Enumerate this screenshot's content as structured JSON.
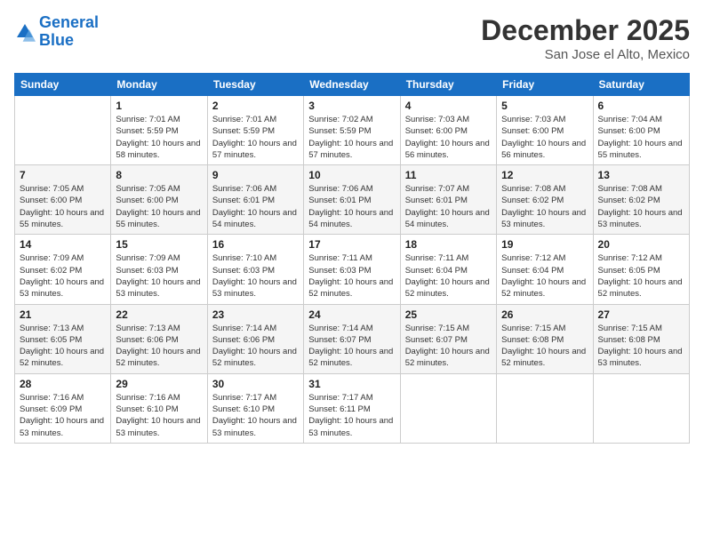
{
  "header": {
    "logo_line1": "General",
    "logo_line2": "Blue",
    "month": "December 2025",
    "location": "San Jose el Alto, Mexico"
  },
  "weekdays": [
    "Sunday",
    "Monday",
    "Tuesday",
    "Wednesday",
    "Thursday",
    "Friday",
    "Saturday"
  ],
  "weeks": [
    [
      {
        "day": "",
        "sunrise": "",
        "sunset": "",
        "daylight": ""
      },
      {
        "day": "1",
        "sunrise": "Sunrise: 7:01 AM",
        "sunset": "Sunset: 5:59 PM",
        "daylight": "Daylight: 10 hours and 58 minutes."
      },
      {
        "day": "2",
        "sunrise": "Sunrise: 7:01 AM",
        "sunset": "Sunset: 5:59 PM",
        "daylight": "Daylight: 10 hours and 57 minutes."
      },
      {
        "day": "3",
        "sunrise": "Sunrise: 7:02 AM",
        "sunset": "Sunset: 5:59 PM",
        "daylight": "Daylight: 10 hours and 57 minutes."
      },
      {
        "day": "4",
        "sunrise": "Sunrise: 7:03 AM",
        "sunset": "Sunset: 6:00 PM",
        "daylight": "Daylight: 10 hours and 56 minutes."
      },
      {
        "day": "5",
        "sunrise": "Sunrise: 7:03 AM",
        "sunset": "Sunset: 6:00 PM",
        "daylight": "Daylight: 10 hours and 56 minutes."
      },
      {
        "day": "6",
        "sunrise": "Sunrise: 7:04 AM",
        "sunset": "Sunset: 6:00 PM",
        "daylight": "Daylight: 10 hours and 55 minutes."
      }
    ],
    [
      {
        "day": "7",
        "sunrise": "Sunrise: 7:05 AM",
        "sunset": "Sunset: 6:00 PM",
        "daylight": "Daylight: 10 hours and 55 minutes."
      },
      {
        "day": "8",
        "sunrise": "Sunrise: 7:05 AM",
        "sunset": "Sunset: 6:00 PM",
        "daylight": "Daylight: 10 hours and 55 minutes."
      },
      {
        "day": "9",
        "sunrise": "Sunrise: 7:06 AM",
        "sunset": "Sunset: 6:01 PM",
        "daylight": "Daylight: 10 hours and 54 minutes."
      },
      {
        "day": "10",
        "sunrise": "Sunrise: 7:06 AM",
        "sunset": "Sunset: 6:01 PM",
        "daylight": "Daylight: 10 hours and 54 minutes."
      },
      {
        "day": "11",
        "sunrise": "Sunrise: 7:07 AM",
        "sunset": "Sunset: 6:01 PM",
        "daylight": "Daylight: 10 hours and 54 minutes."
      },
      {
        "day": "12",
        "sunrise": "Sunrise: 7:08 AM",
        "sunset": "Sunset: 6:02 PM",
        "daylight": "Daylight: 10 hours and 53 minutes."
      },
      {
        "day": "13",
        "sunrise": "Sunrise: 7:08 AM",
        "sunset": "Sunset: 6:02 PM",
        "daylight": "Daylight: 10 hours and 53 minutes."
      }
    ],
    [
      {
        "day": "14",
        "sunrise": "Sunrise: 7:09 AM",
        "sunset": "Sunset: 6:02 PM",
        "daylight": "Daylight: 10 hours and 53 minutes."
      },
      {
        "day": "15",
        "sunrise": "Sunrise: 7:09 AM",
        "sunset": "Sunset: 6:03 PM",
        "daylight": "Daylight: 10 hours and 53 minutes."
      },
      {
        "day": "16",
        "sunrise": "Sunrise: 7:10 AM",
        "sunset": "Sunset: 6:03 PM",
        "daylight": "Daylight: 10 hours and 53 minutes."
      },
      {
        "day": "17",
        "sunrise": "Sunrise: 7:11 AM",
        "sunset": "Sunset: 6:03 PM",
        "daylight": "Daylight: 10 hours and 52 minutes."
      },
      {
        "day": "18",
        "sunrise": "Sunrise: 7:11 AM",
        "sunset": "Sunset: 6:04 PM",
        "daylight": "Daylight: 10 hours and 52 minutes."
      },
      {
        "day": "19",
        "sunrise": "Sunrise: 7:12 AM",
        "sunset": "Sunset: 6:04 PM",
        "daylight": "Daylight: 10 hours and 52 minutes."
      },
      {
        "day": "20",
        "sunrise": "Sunrise: 7:12 AM",
        "sunset": "Sunset: 6:05 PM",
        "daylight": "Daylight: 10 hours and 52 minutes."
      }
    ],
    [
      {
        "day": "21",
        "sunrise": "Sunrise: 7:13 AM",
        "sunset": "Sunset: 6:05 PM",
        "daylight": "Daylight: 10 hours and 52 minutes."
      },
      {
        "day": "22",
        "sunrise": "Sunrise: 7:13 AM",
        "sunset": "Sunset: 6:06 PM",
        "daylight": "Daylight: 10 hours and 52 minutes."
      },
      {
        "day": "23",
        "sunrise": "Sunrise: 7:14 AM",
        "sunset": "Sunset: 6:06 PM",
        "daylight": "Daylight: 10 hours and 52 minutes."
      },
      {
        "day": "24",
        "sunrise": "Sunrise: 7:14 AM",
        "sunset": "Sunset: 6:07 PM",
        "daylight": "Daylight: 10 hours and 52 minutes."
      },
      {
        "day": "25",
        "sunrise": "Sunrise: 7:15 AM",
        "sunset": "Sunset: 6:07 PM",
        "daylight": "Daylight: 10 hours and 52 minutes."
      },
      {
        "day": "26",
        "sunrise": "Sunrise: 7:15 AM",
        "sunset": "Sunset: 6:08 PM",
        "daylight": "Daylight: 10 hours and 52 minutes."
      },
      {
        "day": "27",
        "sunrise": "Sunrise: 7:15 AM",
        "sunset": "Sunset: 6:08 PM",
        "daylight": "Daylight: 10 hours and 53 minutes."
      }
    ],
    [
      {
        "day": "28",
        "sunrise": "Sunrise: 7:16 AM",
        "sunset": "Sunset: 6:09 PM",
        "daylight": "Daylight: 10 hours and 53 minutes."
      },
      {
        "day": "29",
        "sunrise": "Sunrise: 7:16 AM",
        "sunset": "Sunset: 6:10 PM",
        "daylight": "Daylight: 10 hours and 53 minutes."
      },
      {
        "day": "30",
        "sunrise": "Sunrise: 7:17 AM",
        "sunset": "Sunset: 6:10 PM",
        "daylight": "Daylight: 10 hours and 53 minutes."
      },
      {
        "day": "31",
        "sunrise": "Sunrise: 7:17 AM",
        "sunset": "Sunset: 6:11 PM",
        "daylight": "Daylight: 10 hours and 53 minutes."
      },
      {
        "day": "",
        "sunrise": "",
        "sunset": "",
        "daylight": ""
      },
      {
        "day": "",
        "sunrise": "",
        "sunset": "",
        "daylight": ""
      },
      {
        "day": "",
        "sunrise": "",
        "sunset": "",
        "daylight": ""
      }
    ]
  ]
}
